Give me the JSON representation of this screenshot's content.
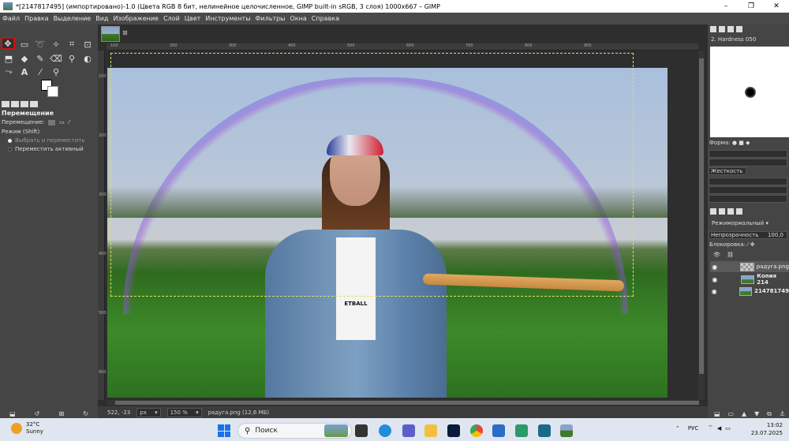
{
  "window": {
    "title": "*[2147817495] (импортировано)-1.0 (Цвета RGB 8 бит, нелинейное целочисленное, GIMP built-in sRGB, 3 слоя) 1000x667 – GIMP",
    "minimize": "–",
    "maximize": "❐",
    "close": "✕"
  },
  "menu": [
    "Файл",
    "Правка",
    "Выделение",
    "Вид",
    "Изображение",
    "Слой",
    "Цвет",
    "Инструменты",
    "Фильтры",
    "Окна",
    "Справка"
  ],
  "tool_options": {
    "title": "Перемещение",
    "move_label": "Перемещение:",
    "mode_label": "Режим (Shift)",
    "option1": "Выбрать и переместить",
    "option2": "Переместить активный"
  },
  "ruler": {
    "h": [
      "100",
      "200",
      "300",
      "400",
      "500",
      "600",
      "700",
      "800",
      "900"
    ],
    "v": [
      "100",
      "200",
      "300",
      "400",
      "500",
      "600"
    ]
  },
  "photo_text": "ETBALL",
  "status": {
    "coords": "522, -23",
    "unit": "px",
    "zoom": "150 %",
    "info": "радуга.png (12,6 МБ)"
  },
  "brushes": {
    "name": "2. Hardness 050",
    "shape_label": "Форма:",
    "hardness_label": "Жесткость"
  },
  "layers": {
    "mode_label": "Режим",
    "mode_value": "ормальный",
    "opacity_label": "Непрозрачность",
    "opacity_value": "100,0",
    "lock_label": "Блокировка:",
    "items": [
      {
        "name": "радуга.png"
      },
      {
        "name": "Копия 214"
      },
      {
        "name": "214781749"
      }
    ]
  },
  "taskbar": {
    "temp": "32°C",
    "weather": "Sunny",
    "search": "Поиск",
    "lang": "РУС",
    "time": "13:02",
    "date": "23.07.2025"
  }
}
